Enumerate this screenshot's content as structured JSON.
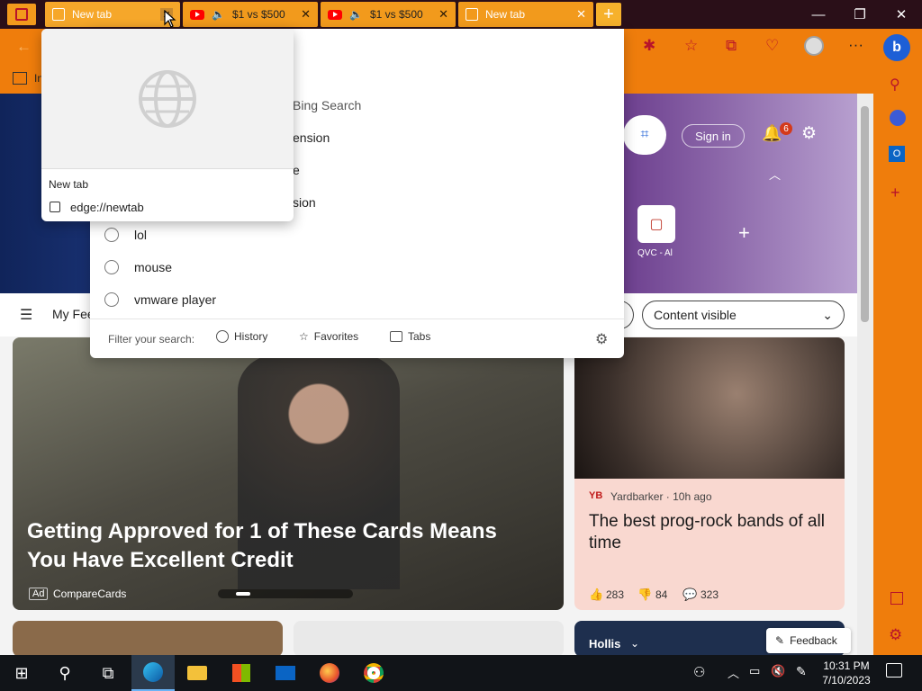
{
  "tabs": [
    {
      "title": "New tab",
      "active": true
    },
    {
      "title": "$1 vs $500"
    },
    {
      "title": "$1 vs $500"
    },
    {
      "title": "New tab"
    }
  ],
  "tooltip": {
    "title": "New tab",
    "url": "edge://newtab"
  },
  "suggest": {
    "rows": [
      "Bing Search",
      "ension",
      "e",
      "sion",
      "lol",
      "mouse",
      "vmware player"
    ],
    "filter_label": "Filter your search:",
    "filters": [
      "History",
      "Favorites",
      "Tabs"
    ]
  },
  "header": {
    "signin": "Sign in",
    "notif_count": "6",
    "qvc": "QVC - Al"
  },
  "feed": {
    "my_feed": "My Fee",
    "content_visible": "Content visible"
  },
  "cards": {
    "main": {
      "headline": "Getting Approved for 1 of These Cards Means You Have Excellent Credit",
      "ad": "Ad",
      "source": "CompareCards"
    },
    "right": {
      "source": "Yardbarker · 10h ago",
      "headline": "The best prog-rock bands of all time",
      "likes": "283",
      "dislikes": "84",
      "comments": "323"
    },
    "bottom_right": {
      "label": "Hollis"
    },
    "feedback": "Feedback"
  },
  "taskbar": {
    "time": "10:31 PM",
    "date": "7/10/2023"
  }
}
